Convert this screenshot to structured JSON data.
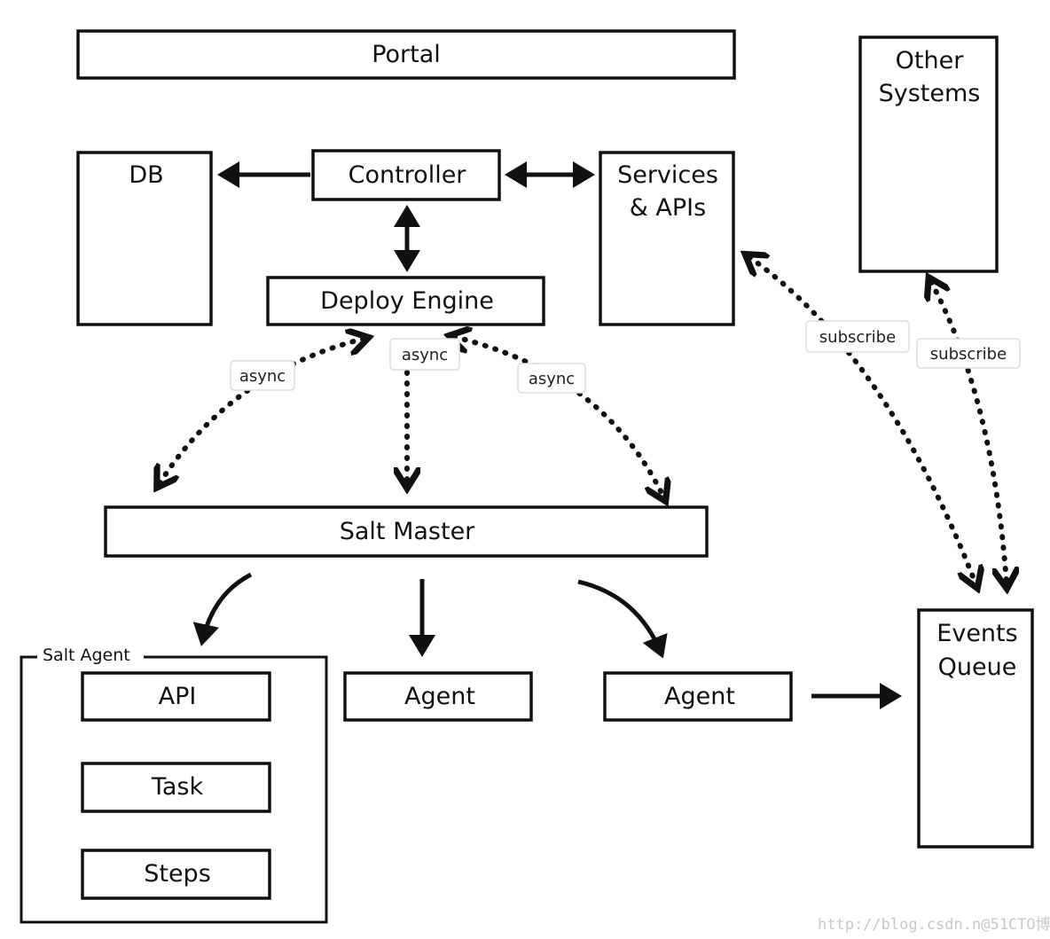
{
  "nodes": {
    "portal": "Portal",
    "other_systems": [
      "Other",
      "Systems"
    ],
    "db": "DB",
    "controller": "Controller",
    "services_apis": [
      "Services",
      "& APIs"
    ],
    "deploy_engine": "Deploy Engine",
    "salt_master": "Salt Master",
    "salt_agent": "Salt Agent",
    "api": "API",
    "task": "Task",
    "steps": "Steps",
    "agent_1": "Agent",
    "agent_2": "Agent",
    "events_queue": [
      "Events",
      "Queue"
    ]
  },
  "edge_labels": {
    "async_left": "async",
    "async_center": "async",
    "async_right": "async",
    "subscribe_services": "subscribe",
    "subscribe_other": "subscribe"
  },
  "watermark": "http://blog.csdn.n@51CTO博客"
}
